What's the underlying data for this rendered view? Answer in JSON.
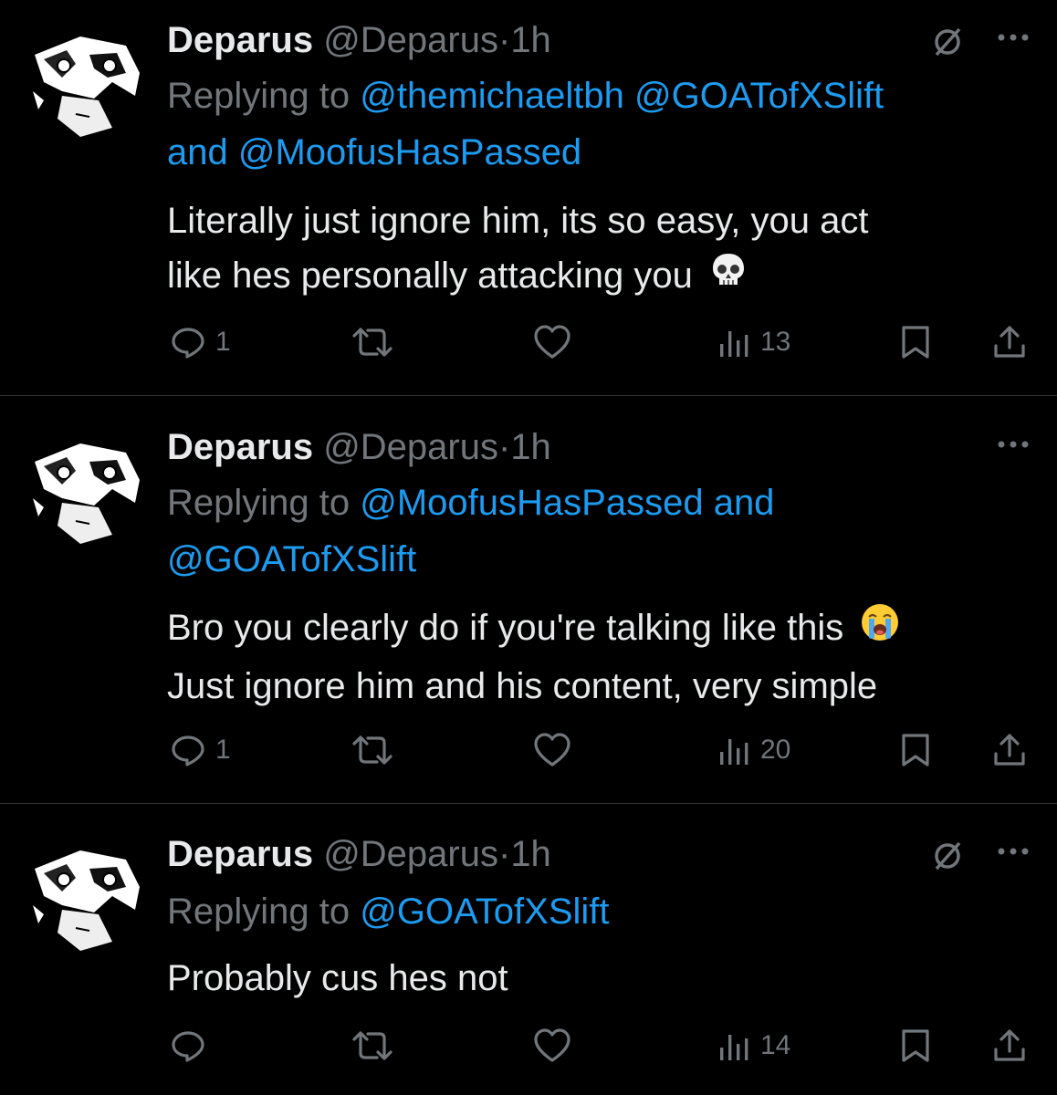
{
  "tweets": [
    {
      "name": "Deparus",
      "handle": "@Deparus",
      "dot": "·",
      "time": "1h",
      "replying_prefix": "Replying to",
      "replying_line1_mentions": "@themichaeltbh @GOATofXSlift",
      "replying_line2": "and @MoofusHasPassed",
      "body_line1": "Literally just ignore him, its so easy, you act",
      "body_line2": "like hes personally attacking you",
      "reply_count": "1",
      "views": "13",
      "emoji": "skull-emoji",
      "muted_icon": true
    },
    {
      "name": "Deparus",
      "handle": "@Deparus",
      "dot": "·",
      "time": "1h",
      "replying_prefix": "Replying to",
      "replying_line1_mentions": "@MoofusHasPassed and",
      "replying_line2": "@GOATofXSlift",
      "body_line1": "Bro you clearly do if you're talking like this",
      "body_line2": "Just ignore him and his content, very simple",
      "reply_count": "1",
      "views": "20",
      "emoji": "loudly-crying-emoji",
      "muted_icon": false
    },
    {
      "name": "Deparus",
      "handle": "@Deparus",
      "dot": "·",
      "time": "1h",
      "replying_prefix": "Replying to",
      "replying_line1_mentions": "@GOATofXSlift",
      "body_line1": "Probably cus hes not",
      "reply_count": "",
      "views": "14",
      "muted_icon": true
    }
  ],
  "colors": {
    "background": "#000000",
    "text": "#e7e9ea",
    "muted": "#71767b",
    "link": "#1d9bf0",
    "divider": "#2f3336"
  }
}
